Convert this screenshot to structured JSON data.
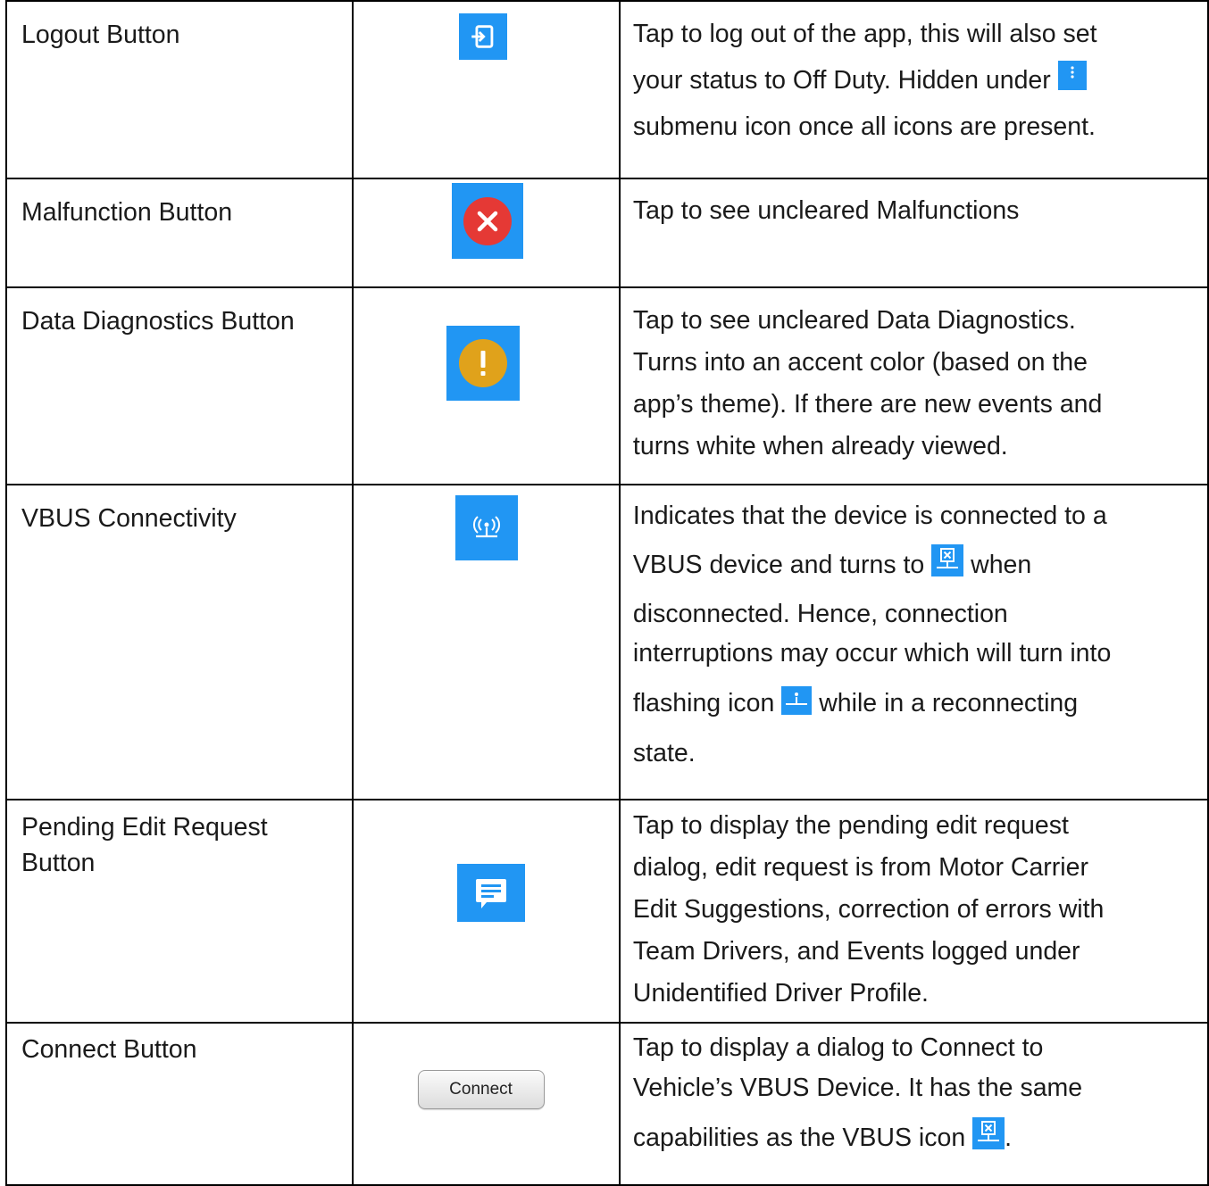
{
  "rows": [
    {
      "name": "Logout Button",
      "desc": [
        "Tap to log out of the app, this will also set",
        "your status to Off Duty. Hidden under",
        "submenu icon once all icons are present."
      ],
      "icon": "logout-icon"
    },
    {
      "name": "Malfunction Button",
      "desc": "Tap to see uncleared Malfunctions",
      "icon": "malfunction-icon"
    },
    {
      "name": "Data Diagnostics Button",
      "desc": [
        "Tap to see uncleared Data Diagnostics.",
        "Turns into an accent color (based on the",
        "app’s theme). If there are new events and",
        "turns white when already viewed."
      ],
      "icon": "data-diagnostics-icon"
    },
    {
      "name": "VBUS Connectivity",
      "desc": [
        "Indicates that the device is connected to a",
        "VBUS device and turns to",
        "when",
        "disconnected. Hence, connection",
        "interruptions may occur which will turn into",
        "flashing icon",
        "while in a reconnecting",
        "state."
      ],
      "icon": "vbus-connected-icon"
    },
    {
      "name_lines": [
        "Pending Edit Request",
        "Button"
      ],
      "desc": [
        "Tap to display the pending edit request",
        "dialog, edit request is from Motor Carrier",
        "Edit Suggestions, correction of errors with",
        "Team Drivers, and Events logged under",
        "Unidentified Driver Profile."
      ],
      "icon": "pending-edit-request-icon"
    },
    {
      "name": "Connect Button",
      "button_label": "Connect",
      "desc": [
        "Tap to display a dialog to Connect to",
        "Vehicle’s VBUS Device. It has the same",
        "capabilities as the VBUS icon",
        "."
      ]
    }
  ],
  "colors": {
    "icon_bg": "#2196f3",
    "malfunction_red": "#e53935",
    "diagnostics_amber": "#e0a21b"
  }
}
